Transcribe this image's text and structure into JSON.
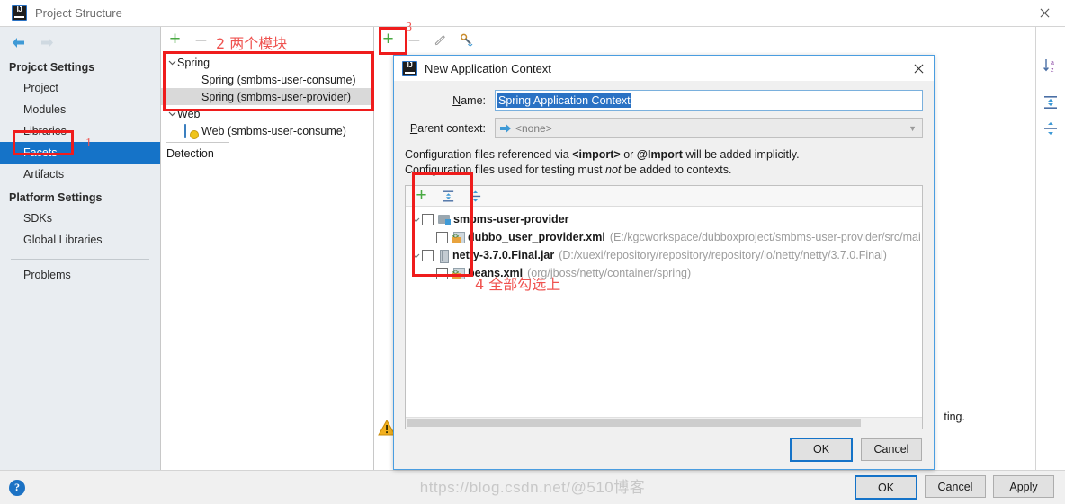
{
  "window": {
    "title": "Project Structure",
    "logo_icon": "intellij-idea-icon",
    "close_icon": "close-icon"
  },
  "nav_buttons": {
    "back_icon": "arrow-left-icon",
    "forward_icon": "arrow-right-icon"
  },
  "sidebar": {
    "groups": [
      {
        "label": "Projcct Settings",
        "items": [
          {
            "label": "Project",
            "selected": false
          },
          {
            "label": "Modules",
            "selected": false
          },
          {
            "label": "Libraries",
            "selected": false
          },
          {
            "label": "Facets",
            "selected": true
          },
          {
            "label": "Artifacts",
            "selected": false
          }
        ]
      },
      {
        "label": "Platform Settings",
        "items": [
          {
            "label": "SDKs",
            "selected": false
          },
          {
            "label": "Global Libraries",
            "selected": false
          }
        ]
      }
    ],
    "problems": "Problems"
  },
  "facet_panel": {
    "toolbar": [
      {
        "name": "add-facet-button",
        "icon": "plus-icon",
        "label": "+"
      },
      {
        "name": "remove-facet-button",
        "icon": "minus-icon",
        "label": "–"
      }
    ],
    "tree": [
      {
        "label": "Spring",
        "type": "group",
        "expanded": true,
        "icon": "chevron-down-icon"
      },
      {
        "label": "Spring (smbms-user-consume)",
        "type": "facet",
        "icon": "spring-leaf-icon",
        "selected": false
      },
      {
        "label": "Spring (smbms-user-provider)",
        "type": "facet",
        "icon": "spring-leaf-icon",
        "selected": true
      },
      {
        "label": "Web",
        "type": "group",
        "expanded": true,
        "icon": "chevron-down-icon"
      },
      {
        "label": "Web (smbms-user-consume)",
        "type": "facet",
        "icon": "web-facet-icon",
        "selected": false
      }
    ],
    "detection": "Detection"
  },
  "content_toolbar": [
    {
      "name": "add-context-button",
      "icon": "plus-icon",
      "label": "+"
    },
    {
      "name": "remove-context-button",
      "icon": "minus-icon",
      "label": "–"
    },
    {
      "name": "edit-context-button",
      "icon": "pencil-icon"
    },
    {
      "name": "configure-button",
      "icon": "wrench-icon"
    }
  ],
  "content_background": {
    "warning_icon": "warning-triangle-icon",
    "partial_text": "ting."
  },
  "right_toolbar": [
    {
      "name": "sort-alphabetically-button",
      "icon": "sort-az-icon"
    },
    {
      "name": "expand-all-button",
      "icon": "expand-all-icon"
    },
    {
      "name": "collapse-all-button",
      "icon": "collapse-all-icon"
    }
  ],
  "dialog": {
    "title": "New Application Context",
    "logo_icon": "intellij-idea-icon",
    "close_icon": "close-icon",
    "name_label": "Name:",
    "name_label_mnemonic": "N",
    "name_value": "Spring Application Context",
    "name_placeholder": "Spring Application Context",
    "parent_label": "Parent context:",
    "parent_label_mnemonic": "P",
    "parent_value": "<none>",
    "parent_icon": "arrow-right-icon",
    "parent_chevron_icon": "chevron-down-icon",
    "note_line1_a": "Configuration files referenced via ",
    "note_line1_b": "<import>",
    "note_line1_c": " or ",
    "note_line1_d": "@Import",
    "note_line1_e": " will be added implicitly.",
    "note_line2_a": "Configuration files used for testing must ",
    "note_line2_b": "not",
    "note_line2_c": " be added to contexts.",
    "list_toolbar": [
      {
        "name": "add-file-button",
        "icon": "plus-icon",
        "label": "+"
      },
      {
        "name": "expand-all-button",
        "icon": "expand-all-icon"
      },
      {
        "name": "collapse-all-button",
        "icon": "collapse-all-icon"
      }
    ],
    "files": [
      {
        "name": "smbms-user-provider",
        "path": "",
        "icon": "module-folder-icon",
        "indent": 0,
        "checked": false,
        "expandable": true
      },
      {
        "name": "dubbo_user_provider.xml",
        "path": "(E:/kgcworkspace/dubboxproject/smbms-user-provider/src/mai",
        "icon": "xml-file-icon",
        "indent": 1,
        "checked": false,
        "expandable": false
      },
      {
        "name": "netty-3.7.0.Final.jar",
        "path": "(D:/xuexi/repository/repository/repository/io/netty/netty/3.7.0.Final)",
        "icon": "jar-file-icon",
        "indent": 0,
        "checked": false,
        "expandable": true
      },
      {
        "name": "beans.xml",
        "path": "(org/jboss/netty/container/spring)",
        "icon": "xml-file-icon",
        "indent": 1,
        "checked": false,
        "expandable": false
      }
    ],
    "ok_label": "OK",
    "cancel_label": "Cancel"
  },
  "footer": {
    "help_icon": "help-icon",
    "help_label": "?",
    "ok_label": "OK",
    "cancel_label": "Cancel",
    "apply_label": "Apply"
  },
  "annotations": [
    {
      "id": "1",
      "number": "1",
      "text": "",
      "target": "facets-sidebar-item"
    },
    {
      "id": "2",
      "number": "2",
      "text": "两个模块",
      "target": "spring-facets"
    },
    {
      "id": "3",
      "number": "3",
      "text": "",
      "target": "add-context-button"
    },
    {
      "id": "4",
      "number": "4",
      "text": "全部勾选上",
      "target": "file-checkboxes"
    }
  ],
  "watermark": "https://blog.csdn.net/@510博客",
  "colors": {
    "accent": "#1573c8",
    "annotation_red": "#ef1c1c",
    "annotation_text": "#ef5350",
    "selection_blue": "#2a72c4",
    "spring_green": "#6cb33f"
  }
}
